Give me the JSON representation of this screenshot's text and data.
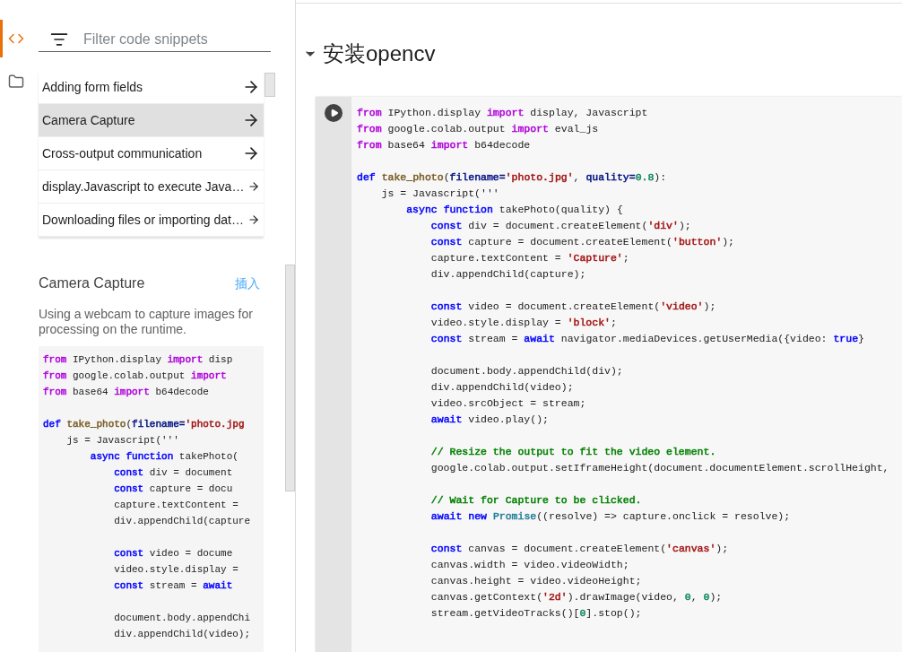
{
  "rail": [
    {
      "kind": "code",
      "selected": true
    },
    {
      "kind": "folder",
      "selected": false
    }
  ],
  "filter": {
    "placeholder": "Filter code snippets"
  },
  "snippets": [
    {
      "label": "Adding form fields",
      "selected": false
    },
    {
      "label": "Camera Capture",
      "selected": true
    },
    {
      "label": "Cross-output communication",
      "selected": false
    },
    {
      "label": "display.Javascript to execute Java…",
      "selected": false
    },
    {
      "label": "Downloading files or importing dat…",
      "selected": false
    }
  ],
  "detail": {
    "title": "Camera Capture",
    "insert_link": "插入",
    "description": "Using a webcam to capture images for processing on the runtime.",
    "code": [
      [
        [
          {
            "t": "from",
            "color": "#af00db"
          },
          {
            "t": " IPython.display "
          },
          {
            "t": "import",
            "color": "#af00db"
          },
          {
            "t": " disp"
          }
        ],
        [
          {
            "t": "from",
            "color": "#af00db"
          },
          {
            "t": " google.colab.output "
          },
          {
            "t": "import",
            "color": "#af00db"
          }
        ],
        [
          {
            "t": "from",
            "color": "#af00db"
          },
          {
            "t": " base64 "
          },
          {
            "t": "import",
            "color": "#af00db"
          },
          {
            "t": " b64decode"
          }
        ]
      ],
      [
        [
          {
            "t": "def",
            "color": "#0000ff"
          },
          {
            "t": " take_photo",
            "color": "#795e26"
          },
          {
            "t": "("
          },
          {
            "t": "filename=",
            "color": "#001080"
          },
          {
            "t": "'photo.jpg",
            "color": "#a31515"
          }
        ],
        [
          {
            "t": "    js = Javascript('''"
          }
        ],
        [
          {
            "t": "        async",
            "color": "#0000ff"
          },
          {
            "t": " function",
            "color": "#0000ff"
          },
          {
            "t": " takePhoto("
          }
        ],
        [
          {
            "t": "            const",
            "color": "#0000ff"
          },
          {
            "t": " div = document"
          }
        ],
        [
          {
            "t": "            const",
            "color": "#0000ff"
          },
          {
            "t": " capture = docu"
          }
        ],
        [
          {
            "t": "            capture.textContent ="
          }
        ],
        [
          {
            "t": "            div.appendChild(capture"
          }
        ]
      ],
      [
        [
          {
            "t": "            const",
            "color": "#0000ff"
          },
          {
            "t": " video = docume"
          }
        ],
        [
          {
            "t": "            video.style.display ="
          }
        ],
        [
          {
            "t": "            const",
            "color": "#0000ff"
          },
          {
            "t": " stream = "
          },
          {
            "t": "await",
            "color": "#0000ff"
          }
        ]
      ],
      [
        [
          {
            "t": "            document.body.appendChi"
          }
        ],
        [
          {
            "t": "            div.appendChild(video);"
          }
        ]
      ]
    ]
  },
  "section": {
    "title": "安装opencv",
    "expanded": true
  },
  "cell": {
    "code": [
      [
        [
          {
            "t": "from",
            "color": "#af00db"
          },
          {
            "t": " IPython.display "
          },
          {
            "t": "import",
            "color": "#af00db"
          },
          {
            "t": " display, Javascript"
          }
        ],
        [
          {
            "t": "from",
            "color": "#af00db"
          },
          {
            "t": " google.colab.output "
          },
          {
            "t": "import",
            "color": "#af00db"
          },
          {
            "t": " eval_js"
          }
        ],
        [
          {
            "t": "from",
            "color": "#af00db"
          },
          {
            "t": " base64 "
          },
          {
            "t": "import",
            "color": "#af00db"
          },
          {
            "t": " b64decode"
          }
        ]
      ],
      [
        [
          {
            "t": "def",
            "color": "#0000ff"
          },
          {
            "t": " take_photo",
            "color": "#795e26"
          },
          {
            "t": "("
          },
          {
            "t": "filename=",
            "color": "#001080"
          },
          {
            "t": "'photo.jpg'",
            "color": "#a31515"
          },
          {
            "t": ", "
          },
          {
            "t": "quality=",
            "color": "#001080"
          },
          {
            "t": "0.8",
            "color": "#098658"
          },
          {
            "t": "):"
          }
        ],
        [
          {
            "t": "    js = Javascript('''"
          }
        ],
        [
          {
            "t": "        async",
            "color": "#0000ff"
          },
          {
            "t": " function",
            "color": "#0000ff"
          },
          {
            "t": " takePhoto(quality) {"
          }
        ],
        [
          {
            "t": "            const",
            "color": "#0000ff"
          },
          {
            "t": " div = document.createElement("
          },
          {
            "t": "'div'",
            "color": "#a31515"
          },
          {
            "t": ");"
          }
        ],
        [
          {
            "t": "            const",
            "color": "#0000ff"
          },
          {
            "t": " capture = document.createElement("
          },
          {
            "t": "'button'",
            "color": "#a31515"
          },
          {
            "t": ");"
          }
        ],
        [
          {
            "t": "            capture.textContent = "
          },
          {
            "t": "'Capture'",
            "color": "#a31515"
          },
          {
            "t": ";"
          }
        ],
        [
          {
            "t": "            div.appendChild(capture);"
          }
        ]
      ],
      [
        [
          {
            "t": "            const",
            "color": "#0000ff"
          },
          {
            "t": " video = document.createElement("
          },
          {
            "t": "'video'",
            "color": "#a31515"
          },
          {
            "t": ");"
          }
        ],
        [
          {
            "t": "            video.style.display = "
          },
          {
            "t": "'block'",
            "color": "#a31515"
          },
          {
            "t": ";"
          }
        ],
        [
          {
            "t": "            const",
            "color": "#0000ff"
          },
          {
            "t": " stream = "
          },
          {
            "t": "await",
            "color": "#0000ff"
          },
          {
            "t": " navigator.mediaDevices.getUserMedia({video: "
          },
          {
            "t": "true",
            "color": "#0000ff"
          },
          {
            "t": "}"
          }
        ]
      ],
      [
        [
          {
            "t": "            document.body.appendChild(div);"
          }
        ],
        [
          {
            "t": "            div.appendChild(video);"
          }
        ],
        [
          {
            "t": "            video.srcObject = stream;"
          }
        ],
        [
          {
            "t": "            await",
            "color": "#0000ff"
          },
          {
            "t": " video.play();"
          }
        ]
      ],
      [
        [
          {
            "t": "            // Resize the output to fit the video element.",
            "color": "#008000"
          }
        ],
        [
          {
            "t": "            google.colab.output.setIframeHeight(document.documentElement.scrollHeight,"
          }
        ]
      ],
      [
        [
          {
            "t": "            // Wait for Capture to be clicked.",
            "color": "#008000"
          }
        ],
        [
          {
            "t": "            await",
            "color": "#0000ff"
          },
          {
            "t": " new",
            "color": "#0000ff"
          },
          {
            "t": " Promise",
            "color": "#267f99"
          },
          {
            "t": "((resolve) => capture.onclick = resolve);"
          }
        ]
      ],
      [
        [
          {
            "t": "            const",
            "color": "#0000ff"
          },
          {
            "t": " canvas = document.createElement("
          },
          {
            "t": "'canvas'",
            "color": "#a31515"
          },
          {
            "t": ");"
          }
        ],
        [
          {
            "t": "            canvas.width = video.videoWidth;"
          }
        ],
        [
          {
            "t": "            canvas.height = video.videoHeight;"
          }
        ],
        [
          {
            "t": "            canvas.getContext("
          },
          {
            "t": "'2d'",
            "color": "#a31515"
          },
          {
            "t": ").drawImage(video, "
          },
          {
            "t": "0",
            "color": "#098658"
          },
          {
            "t": ", "
          },
          {
            "t": "0",
            "color": "#098658"
          },
          {
            "t": ");"
          }
        ],
        [
          {
            "t": "            stream.getVideoTracks()["
          },
          {
            "t": "0",
            "color": "#098658"
          },
          {
            "t": "].stop();"
          }
        ]
      ]
    ]
  }
}
